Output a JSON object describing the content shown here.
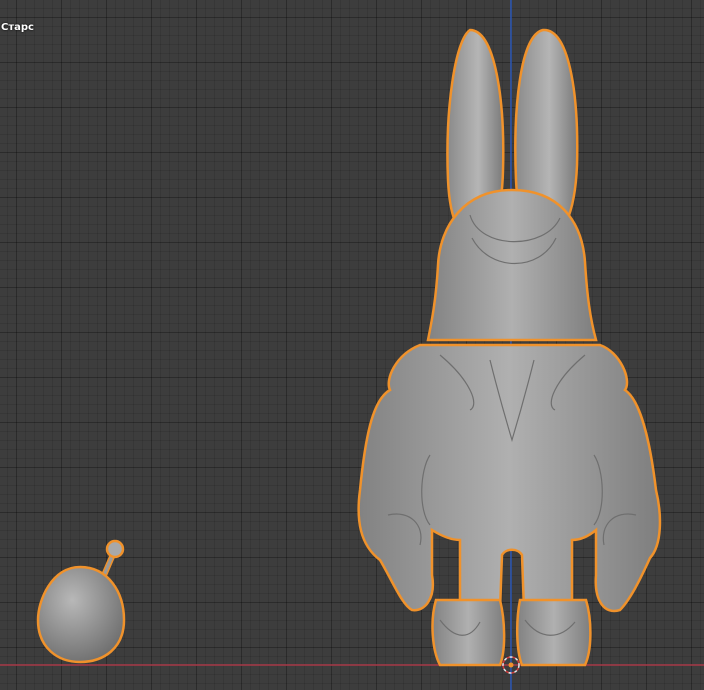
{
  "viewport": {
    "label": "Старс",
    "background_color": "#3d3d3d",
    "grid_color": "#353535",
    "x_axis_color": "#a83a48",
    "z_axis_color": "#2e5ab8",
    "selection_outline_color": "#f0922b",
    "mesh_color": "#9a9a9a"
  },
  "objects": [
    {
      "name": "bunny-character",
      "selected": true
    },
    {
      "name": "egg-creature",
      "selected": true
    }
  ],
  "icons": [
    "3d-cursor-icon"
  ]
}
